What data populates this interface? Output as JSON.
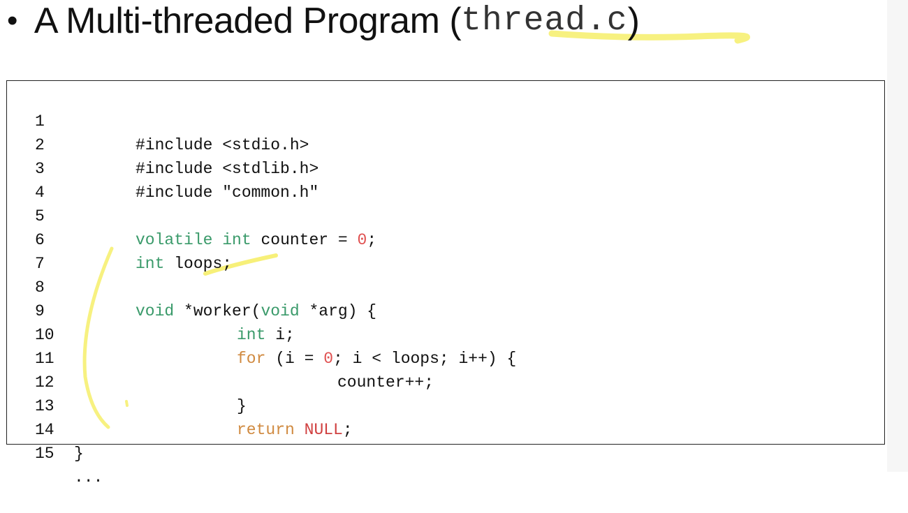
{
  "slide": {
    "bullet": "•",
    "title_text": "A Multi-threaded Program (",
    "filename": "thread.c",
    "title_close": ")"
  },
  "code": {
    "lines": [
      {
        "num": "1",
        "text": "#include <stdio.h>"
      },
      {
        "num": "2",
        "text": "#include <stdlib.h>"
      },
      {
        "num": "3",
        "text": "#include \"common.h\""
      },
      {
        "num": "4",
        "text": ""
      },
      {
        "num": "5",
        "parts": [
          "volatile",
          "int",
          "counter =",
          "0",
          ";"
        ]
      },
      {
        "num": "6",
        "parts": [
          "int",
          "loops;"
        ]
      },
      {
        "num": "7",
        "text": ""
      },
      {
        "num": "8",
        "parts": [
          "void",
          "*worker(",
          "void",
          "*arg) {"
        ]
      },
      {
        "num": "9",
        "parts": [
          "int",
          "i;"
        ]
      },
      {
        "num": "10",
        "parts": [
          "for",
          "(i =",
          "0",
          "; i < loops; i++) {"
        ]
      },
      {
        "num": "11",
        "text": "counter++;"
      },
      {
        "num": "12",
        "text": "}"
      },
      {
        "num": "13",
        "parts": [
          "return",
          "NULL",
          ";"
        ]
      },
      {
        "num": "14",
        "text": "}"
      },
      {
        "num": "15",
        "text": "..."
      }
    ]
  },
  "colors": {
    "keyword_green": "#3a9a6a",
    "keyword_orange": "#d08a40",
    "literal_red": "#e05050",
    "highlight_yellow": "#f6ee6a"
  }
}
